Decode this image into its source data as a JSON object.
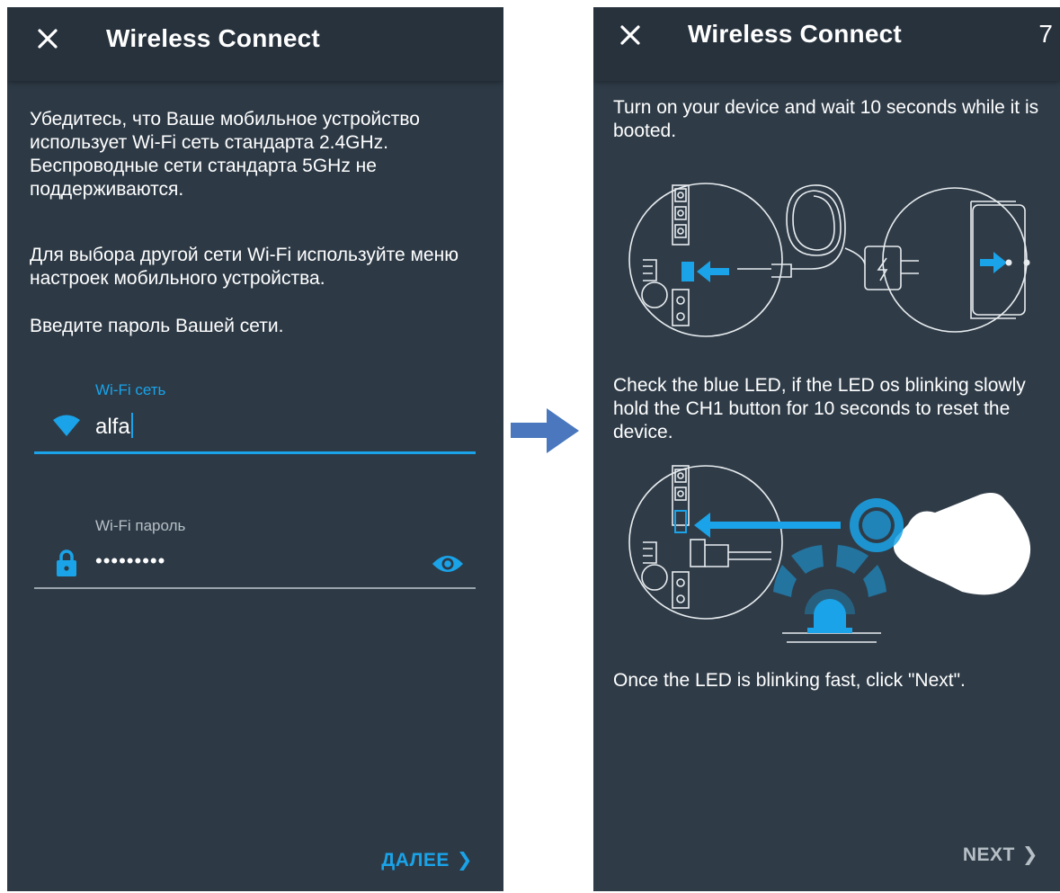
{
  "colors": {
    "background": "#2d3a46",
    "appbar": "#27323d",
    "accent": "#1aa3e8",
    "arrow": "#4a77bd",
    "muted": "#b7bfc6"
  },
  "left_screen": {
    "appbar": {
      "close_icon": "close-icon",
      "title": "Wireless Connect"
    },
    "paragraphs": [
      "Убедитесь, что Ваше мобильное устройство использует Wi-Fi сеть стандарта 2.4GHz. Беспроводные сети стандарта 5GHz не поддерживаются.",
      "Для выбора другой сети Wi-Fi используйте меню настроек мобильного устройства.",
      "Введите пароль Вашей сети."
    ],
    "wifi_field": {
      "label": "Wi-Fi сеть",
      "value": "alfa",
      "icon": "wifi-icon"
    },
    "password_field": {
      "label": "Wi-Fi пароль",
      "value": "•••••••••",
      "icon": "lock-icon",
      "toggle_icon": "eye-icon"
    },
    "next_button": {
      "label": "ДАЛЕЕ",
      "icon": "chevron-right-icon"
    }
  },
  "transition_arrow_icon": "arrow-right-icon",
  "right_screen": {
    "appbar": {
      "close_icon": "close-icon",
      "title": "Wireless Connect",
      "step": "7"
    },
    "paragraphs": [
      "Turn on your device and wait 10 seconds while it is booted.",
      "Check the blue LED, if the LED os blinking slowly hold the CH1 button for 10 seconds to reset the device.",
      "Once the LED is blinking fast, click \"Next\"."
    ],
    "illustrations": [
      "power-plug-illustration",
      "reset-button-illustration"
    ],
    "next_button": {
      "label": "NEXT",
      "icon": "chevron-right-icon"
    }
  }
}
